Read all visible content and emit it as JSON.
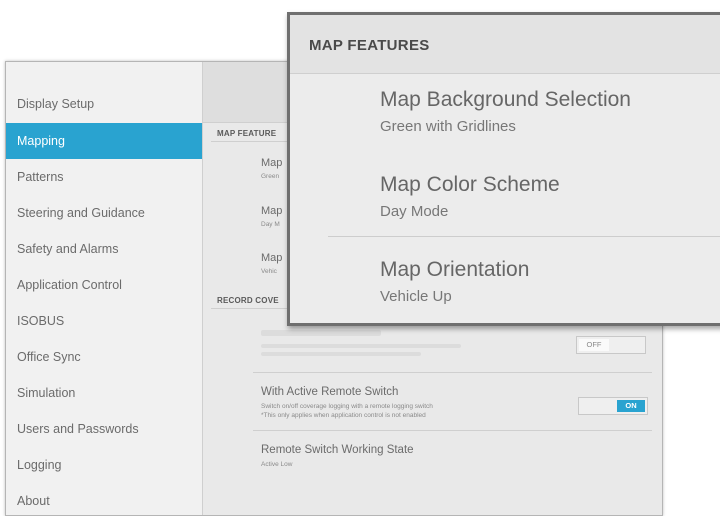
{
  "sidebar": {
    "items": [
      {
        "label": "Display Setup",
        "active": false
      },
      {
        "label": "Mapping",
        "active": true
      },
      {
        "label": "Patterns",
        "active": false
      },
      {
        "label": "Steering and Guidance",
        "active": false
      },
      {
        "label": "Safety and Alarms",
        "active": false
      },
      {
        "label": "Application Control",
        "active": false
      },
      {
        "label": "ISOBUS",
        "active": false
      },
      {
        "label": "Office Sync",
        "active": false
      },
      {
        "label": "Simulation",
        "active": false
      },
      {
        "label": "Users and Passwords",
        "active": false
      },
      {
        "label": "Logging",
        "active": false
      },
      {
        "label": "About",
        "active": false
      }
    ]
  },
  "background_panel": {
    "map_features_header": "MAP FEATURE",
    "map_items": [
      {
        "title": "Map",
        "subtitle": "Green"
      },
      {
        "title": "Map",
        "subtitle": "Day M"
      },
      {
        "title": "Map",
        "subtitle": "Vehic"
      }
    ],
    "record_coverage_header": "RECORD COVE",
    "faded_toggle": {
      "off_label": "OFF"
    },
    "active_remote_switch": {
      "title": "With Active Remote Switch",
      "description_1": "Switch on/off coverage logging with a remote logging switch",
      "description_2": "*This only applies when application control is not enabled",
      "on_label": "ON"
    },
    "remote_switch_state": {
      "title": "Remote Switch Working State",
      "value": "Active Low"
    }
  },
  "popup": {
    "header": "MAP FEATURES",
    "items": [
      {
        "title": "Map Background Selection",
        "subtitle": "Green with Gridlines"
      },
      {
        "title": "Map Color Scheme",
        "subtitle": "Day Mode"
      },
      {
        "title": "Map Orientation",
        "subtitle": "Vehicle Up"
      }
    ]
  },
  "colors": {
    "accent": "#29a3d0",
    "sidebar_bg": "#f1f1f1",
    "panel_bg": "#e9e9e9",
    "popup_border": "#6f6f6f"
  }
}
